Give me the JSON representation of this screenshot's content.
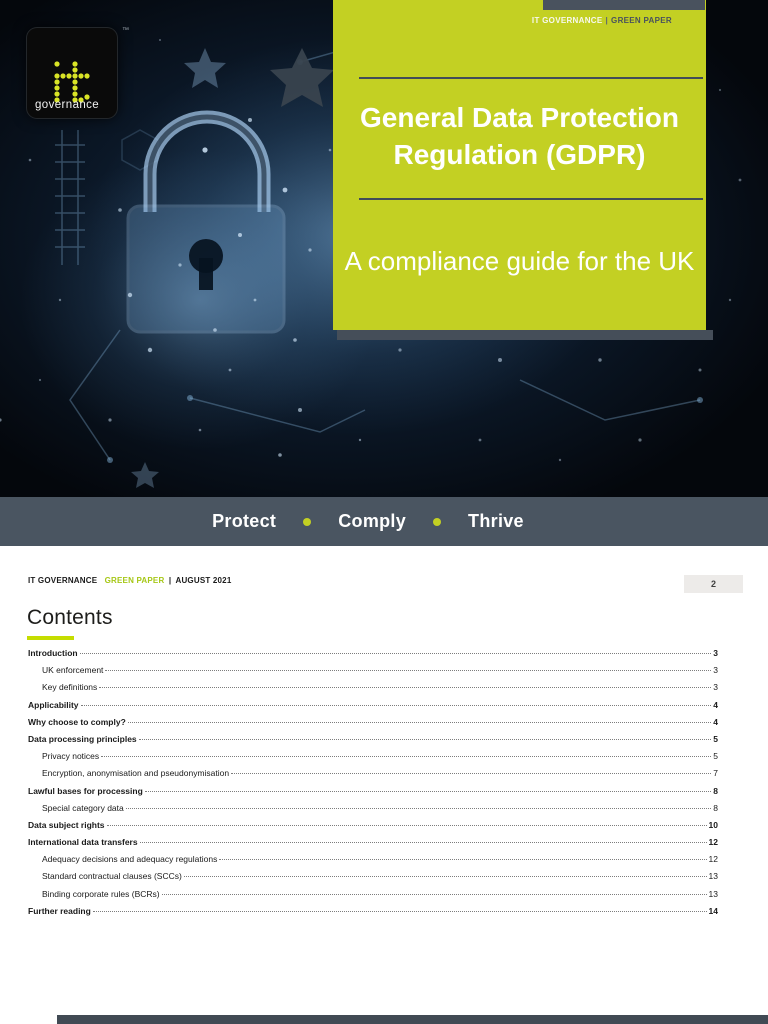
{
  "cover": {
    "logo": {
      "word": "governance",
      "tm": "™",
      "glyph": "it-dot-matrix-logo"
    },
    "kicker": {
      "brand": "IT GOVERNANCE",
      "sep": "|",
      "type": "GREEN PAPER"
    },
    "title_line1": "General Data Protection",
    "title_line2": "Regulation (GDPR)",
    "subtitle": "A compliance guide for the UK",
    "colors": {
      "green": "#c3d023",
      "slate": "#4a5561",
      "divider": "#414c58"
    }
  },
  "tagline": {
    "word1": "Protect",
    "word2": "Comply",
    "word3": "Thrive",
    "dot_color": "#c3d023"
  },
  "page": {
    "header": {
      "brand": "IT GOVERNANCE",
      "type": "GREEN PAPER",
      "sep": "|",
      "date": "AUGUST 2021"
    },
    "page_number": "2",
    "contents_title": "Contents",
    "toc": [
      {
        "label": "Introduction",
        "page": "3",
        "level": 1
      },
      {
        "label": "UK enforcement",
        "page": "3",
        "level": 2
      },
      {
        "label": "Key definitions",
        "page": "3",
        "level": 2
      },
      {
        "label": "Applicability",
        "page": "4",
        "level": 1
      },
      {
        "label": "Why choose to comply?",
        "page": "4",
        "level": 1
      },
      {
        "label": "Data processing principles",
        "page": "5",
        "level": 1
      },
      {
        "label": "Privacy notices",
        "page": "5",
        "level": 2
      },
      {
        "label": "Encryption, anonymisation and pseudonymisation",
        "page": "7",
        "level": 2
      },
      {
        "label": "Lawful bases for processing",
        "page": "8",
        "level": 1
      },
      {
        "label": "Special category data",
        "page": "8",
        "level": 2
      },
      {
        "label": "Data subject rights",
        "page": "10",
        "level": 1
      },
      {
        "label": "International data transfers",
        "page": "12",
        "level": 1
      },
      {
        "label": "Adequacy decisions and adequacy regulations",
        "page": "12",
        "level": 2
      },
      {
        "label": "Standard contractual clauses (SCCs)",
        "page": "13",
        "level": 2
      },
      {
        "label": "Binding corporate rules (BCRs)",
        "page": "13",
        "level": 2
      },
      {
        "label": "Further reading",
        "page": "14",
        "level": 1
      }
    ]
  }
}
